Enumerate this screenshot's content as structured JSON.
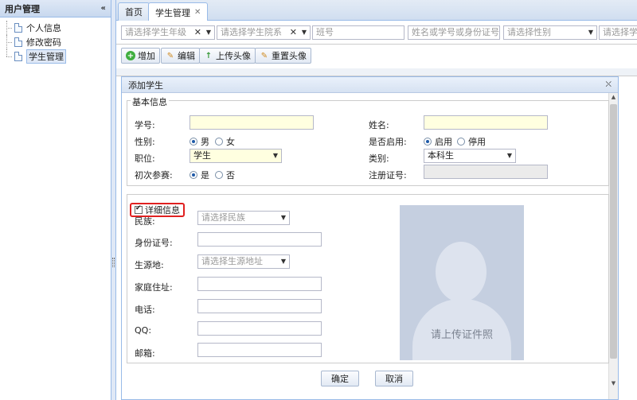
{
  "sidebar": {
    "title": "用户管理",
    "items": [
      {
        "label": "个人信息"
      },
      {
        "label": "修改密码"
      },
      {
        "label": "学生管理"
      }
    ]
  },
  "tabs": [
    {
      "label": "首页"
    },
    {
      "label": "学生管理"
    }
  ],
  "filters": {
    "grade_placeholder": "请选择学生年级",
    "college_placeholder": "请选择学生院系",
    "class_placeholder": "班号",
    "search_placeholder": "姓名或学号或身份证号",
    "gender_placeholder": "请选择性别",
    "more_placeholder": "请选择学生"
  },
  "toolbar": {
    "add": "增加",
    "edit": "编辑",
    "upload": "上传头像",
    "reset": "重置头像"
  },
  "dialog": {
    "title": "添加学生",
    "basic": {
      "legend": "基本信息",
      "student_id_label": "学号:",
      "name_label": "姓名:",
      "gender_label": "性别:",
      "gender_male": "男",
      "gender_female": "女",
      "enabled_label": "是否启用:",
      "enabled_on": "启用",
      "enabled_off": "停用",
      "position_label": "职位:",
      "position_value": "学生",
      "category_label": "类别:",
      "category_value": "本科生",
      "first_label": "初次参赛:",
      "first_yes": "是",
      "first_no": "否",
      "reg_label": "注册证号:"
    },
    "detail": {
      "legend": "详细信息",
      "ethnic_label": "民族:",
      "ethnic_placeholder": "请选择民族",
      "idcard_label": "身份证号:",
      "origin_label": "生源地:",
      "origin_placeholder": "请选择生源地址",
      "address_label": "家庭住址:",
      "phone_label": "电话:",
      "qq_label": "QQ:",
      "email_label": "邮箱:",
      "photo_text": "请上传证件照"
    },
    "ok": "确定",
    "cancel": "取消"
  }
}
